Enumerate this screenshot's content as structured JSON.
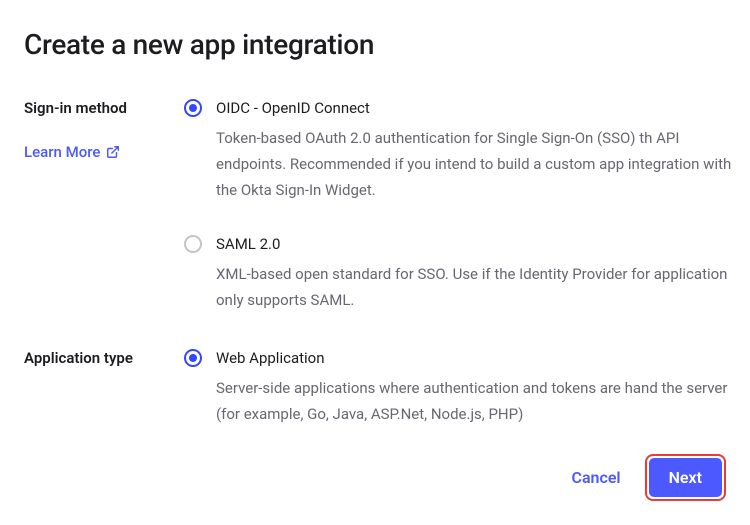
{
  "title": "Create a new app integration",
  "signInMethod": {
    "label": "Sign-in method",
    "learnMoreText": "Learn More",
    "options": [
      {
        "title": "OIDC - OpenID Connect",
        "description": "Token-based OAuth 2.0 authentication for Single Sign-On (SSO) th API endpoints. Recommended if you intend to build a custom app integration with the Okta Sign-In Widget.",
        "selected": true
      },
      {
        "title": "SAML 2.0",
        "description": "XML-based open standard for SSO. Use if the Identity Provider for application only supports SAML.",
        "selected": false
      }
    ]
  },
  "applicationType": {
    "label": "Application type",
    "options": [
      {
        "title": "Web Application",
        "description": "Server-side applications where authentication and tokens are hand the server (for example, Go, Java, ASP.Net, Node.js, PHP)",
        "selected": true
      }
    ]
  },
  "footer": {
    "cancel": "Cancel",
    "next": "Next"
  },
  "colors": {
    "accent": "#4c59ff",
    "highlight": "#e83b3b",
    "textSecondary": "#676773"
  }
}
